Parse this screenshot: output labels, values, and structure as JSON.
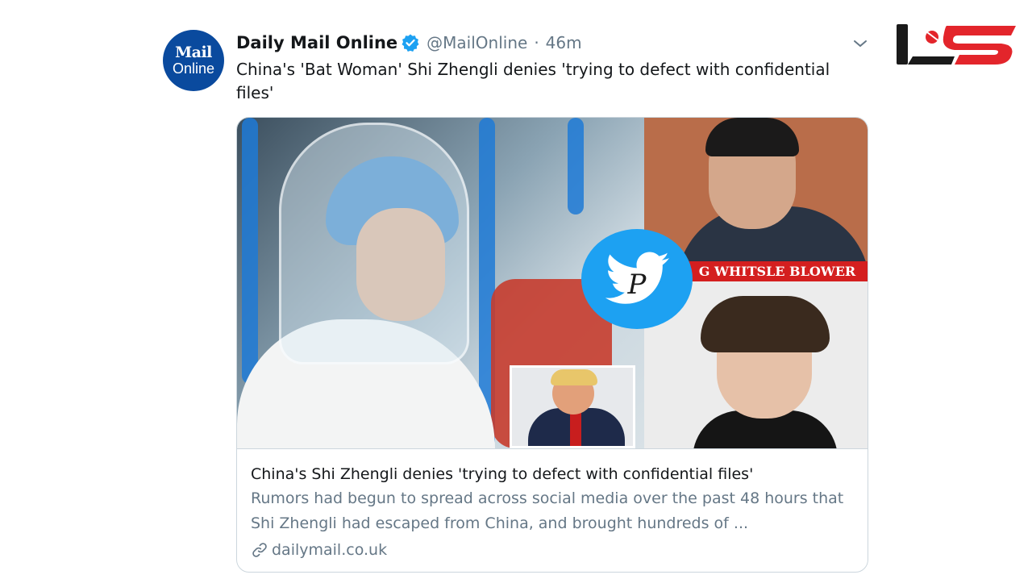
{
  "tweet": {
    "author_name": "Daily Mail Online",
    "handle": "@MailOnline",
    "separator": "·",
    "time": "46m",
    "text": "China's 'Bat Woman' Shi Zhengli denies 'trying to defect with confidential files'",
    "avatar": {
      "line1": "Mail",
      "line2": "Online"
    }
  },
  "card": {
    "image_banner": "G WHITSLE BLOWER",
    "watermark_letter": "P",
    "title": "China's Shi Zhengli denies 'trying to defect with confidential files'",
    "description": "Rumors had begun to spread across social media over the past 48 hours that Shi Zhengli had escaped from China, and brought hundreds of ...",
    "domain": "dailymail.co.uk"
  },
  "icons": {
    "verified": "verified-badge-icon",
    "menu": "chevron-down-icon",
    "link": "link-icon",
    "watermark": "twitter-bird-icon"
  },
  "colors": {
    "verified": "#1da1f2",
    "text_secondary": "#657786",
    "brand_red": "#e3252b",
    "brand_dark": "#1a1a1a"
  }
}
